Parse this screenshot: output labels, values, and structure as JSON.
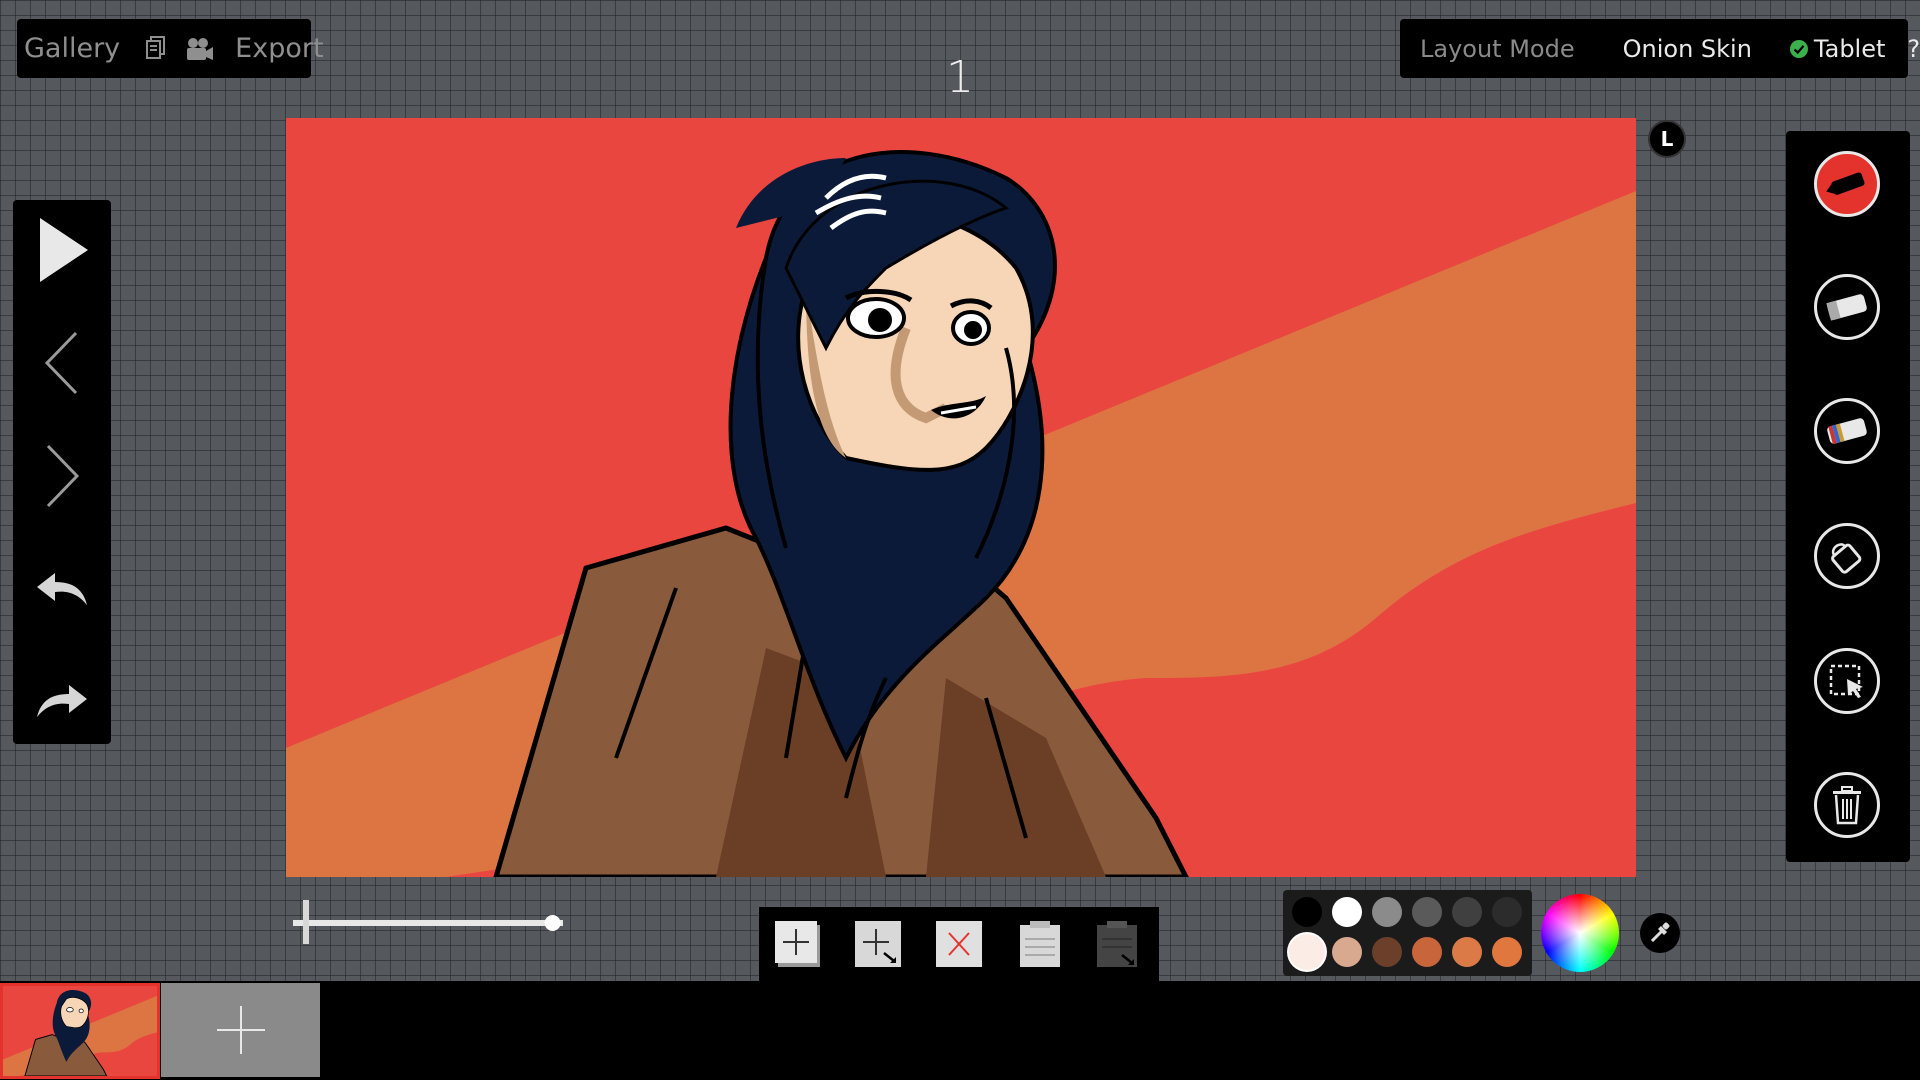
{
  "top_left": {
    "gallery_label": "Gallery",
    "frames_icon": "frames-icon",
    "camera_icon": "camera-icon",
    "export_label": "Export"
  },
  "top_right": {
    "layout_mode_label": "Layout Mode",
    "onion_skin_label": "Onion Skin",
    "tablet_label": "Tablet",
    "tablet_enabled": true,
    "help_label": "?"
  },
  "frame_number": "1",
  "layer_badge": "L",
  "left_toolbar": [
    "play-icon",
    "previous-frame-icon",
    "next-frame-icon",
    "undo-icon",
    "redo-icon"
  ],
  "right_toolbar": [
    "marker-icon",
    "eraser-icon",
    "multi-eraser-icon",
    "paint-bucket-icon",
    "selection-icon",
    "trash-icon"
  ],
  "active_tool": "marker-icon",
  "opacity_slider_value": 0.96,
  "frame_actions": [
    "add-frame-icon",
    "add-frame-after-icon",
    "delete-frame-icon",
    "paste-frame-icon",
    "paste-frame-after-icon"
  ],
  "palette": {
    "colors": [
      "#000000",
      "#ffffff",
      "#8b8b8b",
      "#5a5a5a",
      "#404040",
      "#2c2c2c",
      "#fbede6",
      "#d8a98f",
      "#6b3f2a",
      "#c8653b",
      "#dc7a47",
      "#e0773f"
    ],
    "selected_index": 6
  },
  "colors": {
    "canvas_background": "#e94640",
    "stripe": "#dd7543",
    "accent_red": "#e4332c",
    "hair": "#0c1a3a",
    "skin": "#f6d6b6",
    "jacket": "#8a5a3c"
  }
}
